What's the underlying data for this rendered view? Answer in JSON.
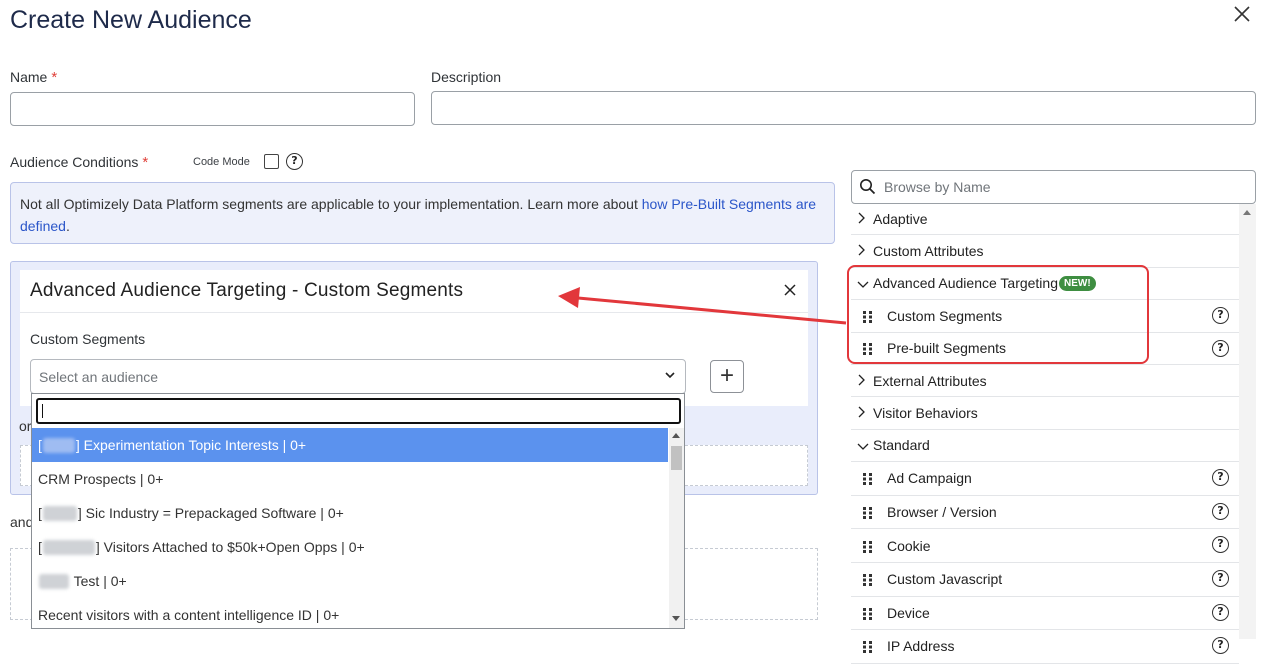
{
  "modal": {
    "title": "Create New Audience",
    "close_icon": "close-icon"
  },
  "form": {
    "name_label": "Name",
    "required_mark": "*",
    "name_value": "",
    "description_label": "Description",
    "description_value": "",
    "conditions_label": "Audience Conditions",
    "code_mode_label": "Code Mode",
    "help_glyph": "?"
  },
  "info": {
    "text": "Not all Optimizely Data Platform segments are applicable to your implementation. Learn more about ",
    "link_text": "how Pre-Built Segments are defined",
    "tail": "."
  },
  "condition": {
    "card_title": "Advanced Audience Targeting - Custom Segments",
    "field_label": "Custom Segments",
    "select_placeholder": "Select an audience",
    "plus_label": "+",
    "or_label": "or",
    "and_label": "and"
  },
  "dropdown": {
    "search_value": "",
    "items": [
      {
        "prefix": "[",
        "redacted": true,
        "text": "] Experimentation Topic Interests | 0+",
        "selected": true
      },
      {
        "prefix": "",
        "redacted": false,
        "text": "CRM Prospects | 0+",
        "selected": false
      },
      {
        "prefix": "[",
        "redacted": true,
        "text": "] Sic Industry = Prepackaged Software | 0+",
        "selected": false
      },
      {
        "prefix": "[",
        "redacted": true,
        "text": "] Visitors Attached to $50k+Open Opps | 0+",
        "selected": false
      },
      {
        "prefix": "",
        "redacted": true,
        "text": " Test | 0+",
        "selected": false
      },
      {
        "prefix": "",
        "redacted": false,
        "text": "Recent visitors with a content intelligence ID | 0+",
        "selected": false
      }
    ]
  },
  "browser": {
    "search_placeholder": "Browse by Name",
    "categories": {
      "adaptive": "Adaptive",
      "custom_attributes": "Custom Attributes",
      "advanced": "Advanced Audience Targeting",
      "new_badge": "NEW!",
      "custom_segments": "Custom Segments",
      "prebuilt_segments": "Pre-built Segments",
      "external_attributes": "External Attributes",
      "visitor_behaviors": "Visitor Behaviors",
      "standard": "Standard"
    },
    "standard_items": [
      "Ad Campaign",
      "Browser / Version",
      "Cookie",
      "Custom Javascript",
      "Device",
      "IP Address"
    ]
  },
  "colors": {
    "accent_link": "#2b56c9",
    "selected_row": "#5b92ee",
    "annotation_red": "#e2373b",
    "new_badge": "#3e8e41"
  }
}
